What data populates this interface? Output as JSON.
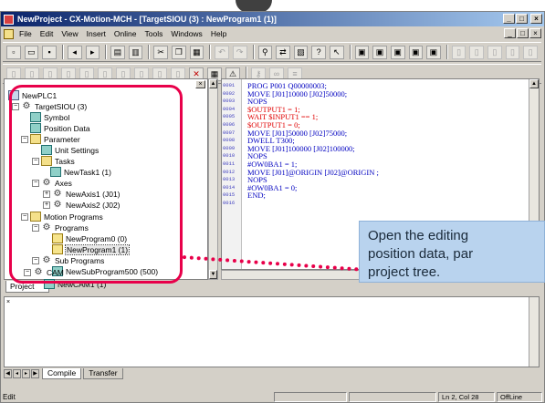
{
  "window": {
    "title": "NewProject - CX-Motion-MCH - [TargetSIOU (3) : NewProgram1 (1)]",
    "buttons": [
      "_",
      "□",
      "×"
    ]
  },
  "menu": {
    "items": [
      "File",
      "Edit",
      "View",
      "Insert",
      "Online",
      "Tools",
      "Windows",
      "Help"
    ],
    "mdi_buttons": [
      "_",
      "□",
      "×"
    ]
  },
  "toolbar1": [
    "new-icon",
    "open-icon",
    "save-icon",
    "back-icon",
    "forward-icon",
    "preview-icon",
    "print-icon",
    "cut-icon",
    "copy-icon",
    "paste-icon",
    "undo-icon",
    "redo-icon",
    "find-icon",
    "replace-icon",
    "properties-icon",
    "help-icon",
    "context-help-icon",
    "window-1-icon",
    "window-2-icon",
    "window-3-icon",
    "window-4-icon",
    "window-5-icon",
    "online-icon",
    "download-icon",
    "upload-icon",
    "compare-icon",
    "monitor-icon"
  ],
  "toolbar2": [
    "tool-a-icon",
    "tool-b-icon",
    "tool-c-icon",
    "tool-d-icon",
    "tool-e-icon",
    "tool-f-icon",
    "tool-g-icon",
    "tool-h-icon",
    "tool-i-icon",
    "tool-j-icon",
    "delete-icon",
    "grid-icon",
    "warning-icon",
    "key-icon",
    "link-icon",
    "list-icon"
  ],
  "tree": {
    "root": "NewPLC1",
    "target": "TargetSIOU (3)",
    "symbol": "Symbol",
    "position_data": "Position Data",
    "parameter": "Parameter",
    "unit_settings": "Unit Settings",
    "tasks": "Tasks",
    "newtask1": "NewTask1 (1)",
    "axes": "Axes",
    "newaxis1": "NewAxis1 (J01)",
    "newaxis2": "NewAxis2 (J02)",
    "motion_programs": "Motion Programs",
    "programs": "Programs",
    "newprogram0": "NewProgram0 (0)",
    "newprogram1": "NewProgram1 (1)",
    "sub_programs": "Sub Programs",
    "newsubprogram": "NewSubProgram500 (500)",
    "cam": "CAM",
    "newcam1": "NewCAM1 (1)"
  },
  "code": {
    "line_numbers": [
      "0001",
      "0002",
      "0003",
      "0004",
      "0005",
      "0006",
      "0007",
      "0008",
      "0009",
      "0010",
      "0011",
      "0012",
      "0013",
      "0014",
      "0015",
      "0016"
    ],
    "lines": [
      "PROG P001 Q00000003;",
      "MOVE [J01]10000 [J02]50000;",
      "NOPS",
      "$OUTPUT1 = 1;",
      "WAIT $INPUT1 == 1;",
      "$OUTPUT1 = 0;",
      "MOVE [J01]50000 [J02]75000;",
      "DWELL T300;",
      "MOVE [J01]100000 [J02]100000;",
      "NOPS",
      "#OW0BA1 = 1;",
      "MOVE [J01]@ORIGIN [J02]@ORIGIN ;",
      "NOPS",
      "#OW0BA1 = 0;",
      "END;",
      ""
    ]
  },
  "tabs": {
    "project": "Project",
    "compile": "Compile",
    "transfer": "Transfer"
  },
  "status": {
    "left": "Edit",
    "position": "Ln 2, Col 28",
    "mode": "OffLine"
  },
  "callout": {
    "line1": "Open the editing",
    "line2": "position data, par",
    "line3": "project tree."
  },
  "colors": {
    "highlight": "#e8004a",
    "callout_bg": "#b9d3ee",
    "titlebar": "#0a246a"
  }
}
